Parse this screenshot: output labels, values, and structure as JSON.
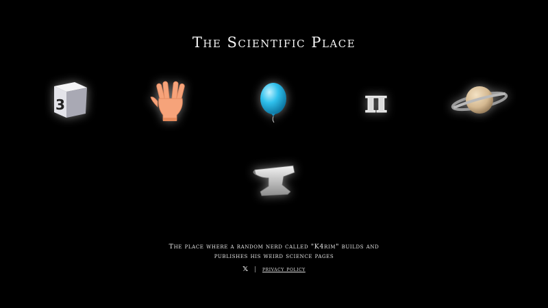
{
  "page": {
    "title": "The Scientific Place"
  },
  "icons": [
    {
      "name": "number-three-cube-icon",
      "label": "3"
    },
    {
      "name": "vulcan-salute-hand-icon"
    },
    {
      "name": "balloon-icon"
    },
    {
      "name": "pi-icon",
      "label": "π"
    },
    {
      "name": "ringed-planet-icon"
    },
    {
      "name": "anvil-icon"
    }
  ],
  "footer": {
    "description_line1": "The place where a random nerd called \"K4rim\" builds and",
    "description_line2": "publishes his weird science pages",
    "x_label": "𝕏",
    "separator": "|",
    "privacy_label": "privacy policy"
  },
  "colors": {
    "background": "#000000",
    "text": "#f2f2f2",
    "balloon": "#29b6e6",
    "hand": "#f6a37a",
    "planet": "#d9c2a0"
  }
}
